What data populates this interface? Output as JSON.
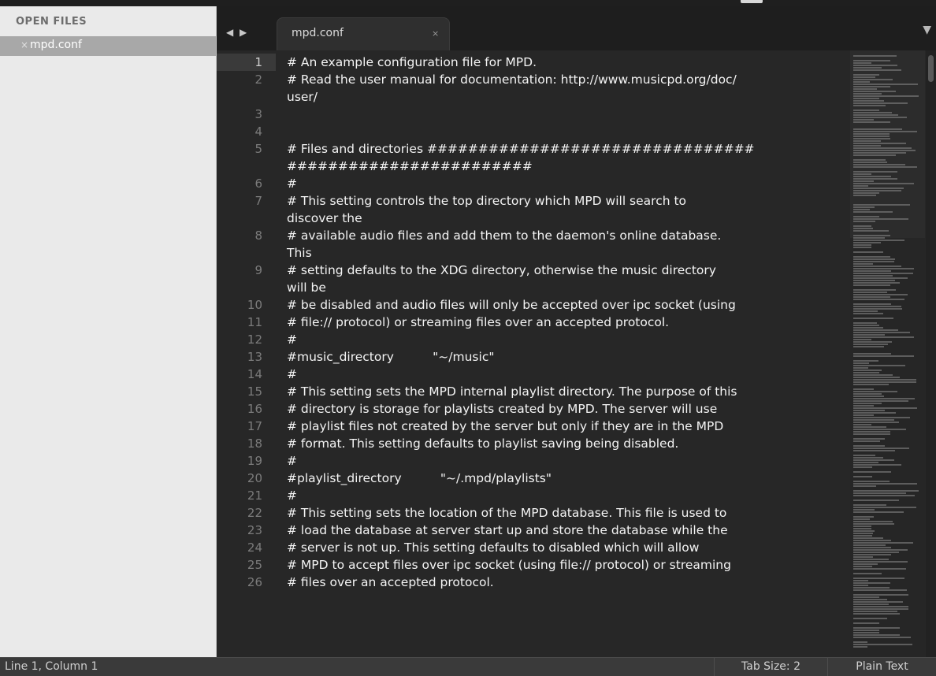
{
  "sidebar": {
    "header": "OPEN FILES",
    "files": [
      {
        "close_glyph": "×",
        "name": "mpd.conf",
        "selected": true
      }
    ]
  },
  "tabs": {
    "nav_glyph": "◀ ▶",
    "items": [
      {
        "label": "mpd.conf",
        "close_glyph": "×",
        "active": true
      }
    ],
    "dropdown_glyph": "▼"
  },
  "editor": {
    "active_line": 1,
    "lines": [
      {
        "n": "1",
        "text": "# An example configuration file for MPD."
      },
      {
        "n": "2",
        "text": "# Read the user manual for documentation: http://www.musicpd.org/doc/\nuser/"
      },
      {
        "n": "3",
        "text": ""
      },
      {
        "n": "4",
        "text": ""
      },
      {
        "n": "5",
        "text": "# Files and directories ################################\n########################"
      },
      {
        "n": "6",
        "text": "#"
      },
      {
        "n": "7",
        "text": "# This setting controls the top directory which MPD will search to\ndiscover the"
      },
      {
        "n": "8",
        "text": "# available audio files and add them to the daemon's online database.\nThis"
      },
      {
        "n": "9",
        "text": "# setting defaults to the XDG directory, otherwise the music directory\nwill be"
      },
      {
        "n": "10",
        "text": "# be disabled and audio files will only be accepted over ipc socket (using"
      },
      {
        "n": "11",
        "text": "# file:// protocol) or streaming files over an accepted protocol."
      },
      {
        "n": "12",
        "text": "#"
      },
      {
        "n": "13",
        "text": "#music_directory          \"~/music\""
      },
      {
        "n": "14",
        "text": "#"
      },
      {
        "n": "15",
        "text": "# This setting sets the MPD internal playlist directory. The purpose of this"
      },
      {
        "n": "16",
        "text": "# directory is storage for playlists created by MPD. The server will use"
      },
      {
        "n": "17",
        "text": "# playlist files not created by the server but only if they are in the MPD"
      },
      {
        "n": "18",
        "text": "# format. This setting defaults to playlist saving being disabled."
      },
      {
        "n": "19",
        "text": "#"
      },
      {
        "n": "20",
        "text": "#playlist_directory          \"~/.mpd/playlists\""
      },
      {
        "n": "21",
        "text": "#"
      },
      {
        "n": "22",
        "text": "# This setting sets the location of the MPD database. This file is used to"
      },
      {
        "n": "23",
        "text": "# load the database at server start up and store the database while the"
      },
      {
        "n": "24",
        "text": "# server is not up. This setting defaults to disabled which will allow"
      },
      {
        "n": "25",
        "text": "# MPD to accept files over ipc socket (using file:// protocol) or streaming"
      },
      {
        "n": "26",
        "text": "# files over an accepted protocol."
      }
    ]
  },
  "status": {
    "position": "Line 1, Column 1",
    "tab_size": "Tab Size: 2",
    "syntax": "Plain Text"
  },
  "colors": {
    "editor_bg": "#272727",
    "sidebar_bg": "#eaeaea",
    "selected_file_bg": "#a8a8a8",
    "text": "#f4f4f4",
    "line_number": "#7c7c7c"
  }
}
